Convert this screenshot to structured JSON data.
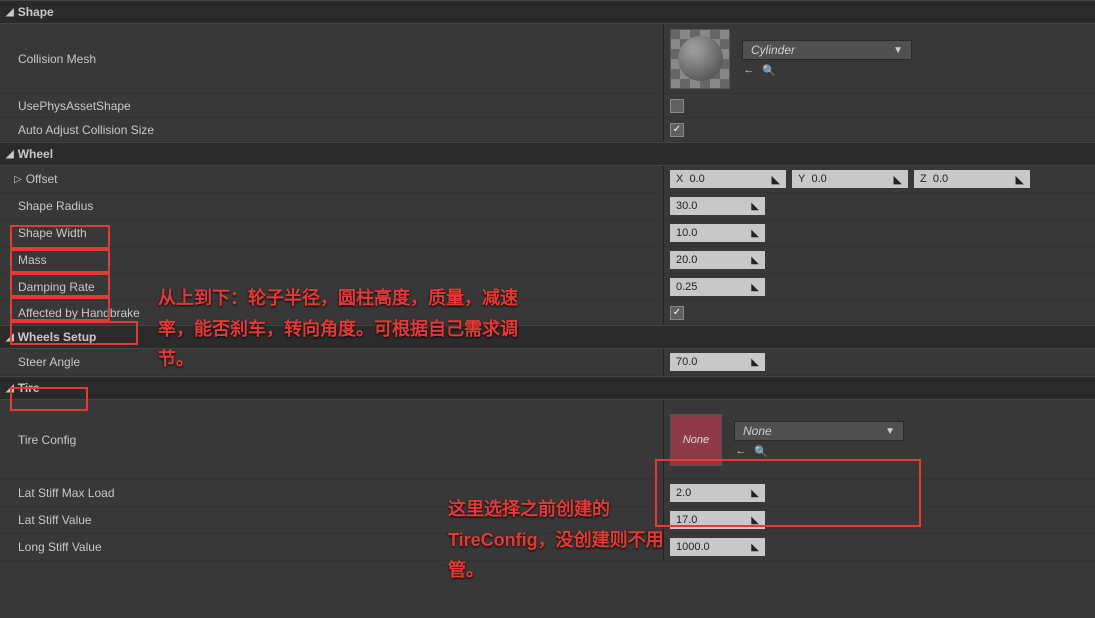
{
  "sections": {
    "shape": "Shape",
    "wheel": "Wheel",
    "wheelsSetup": "Wheels Setup",
    "tire": "Tire"
  },
  "shape": {
    "collisionMesh": "Collision Mesh",
    "meshDropdown": "Cylinder",
    "usePhysAssetShape": "UsePhysAssetShape",
    "autoAdjust": "Auto Adjust Collision Size"
  },
  "wheel": {
    "offset": "Offset",
    "x": {
      "label": "X",
      "value": "0.0"
    },
    "y": {
      "label": "Y",
      "value": "0.0"
    },
    "z": {
      "label": "Z",
      "value": "0.0"
    },
    "shapeRadius": "Shape Radius",
    "shapeRadiusVal": "30.0",
    "shapeWidth": "Shape Width",
    "shapeWidthVal": "10.0",
    "mass": "Mass",
    "massVal": "20.0",
    "dampingRate": "Damping Rate",
    "dampingRateVal": "0.25",
    "affected": "Affected by Handbrake"
  },
  "wheelsSetup": {
    "steerAngle": "Steer Angle",
    "steerAngleVal": "70.0"
  },
  "tire": {
    "tireConfig": "Tire Config",
    "noneLabel": "None",
    "dropdownNone": "None",
    "latStiffMaxLoad": "Lat Stiff Max Load",
    "latStiffMaxLoadVal": "2.0",
    "latStiffValue": "Lat Stiff Value",
    "latStiffValueVal": "17.0",
    "longStiffValue": "Long Stiff Value",
    "longStiffValueVal": "1000.0"
  },
  "annotations": {
    "main": "从上到下：轮子半径，圆柱高度，质量，减速率，能否刹车，转向角度。可根据自己需求调节。",
    "tire": "这里选择之前创建的TireConfig，没创建则不用管。"
  }
}
